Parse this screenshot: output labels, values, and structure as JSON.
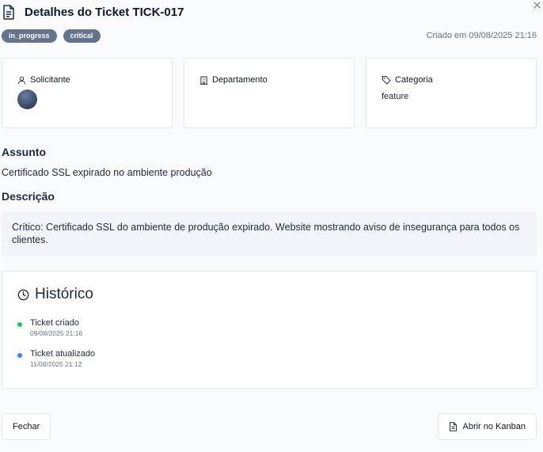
{
  "header": {
    "title": "Detalhes do Ticket TICK-017",
    "created": "Criado em 09/08/2025 21:16"
  },
  "badges": [
    "in_progress",
    "critical"
  ],
  "cards": {
    "requester": {
      "label": "Solicitante"
    },
    "department": {
      "label": "Departamento"
    },
    "category": {
      "label": "Categoria",
      "value": "feature"
    }
  },
  "subject": {
    "label": "Assunto",
    "text": "Certificado SSL expirado no ambiente produção"
  },
  "description": {
    "label": "Descrição",
    "text": "Crítico: Certificado SSL do ambiente de produção expirado. Website mostrando aviso de insegurança para todos os clientes."
  },
  "history": {
    "title": "Histórico",
    "events": [
      {
        "title": "Ticket criado",
        "date": "09/08/2025 21:16",
        "color": "#22c55e"
      },
      {
        "title": "Ticket atualizado",
        "date": "11/08/2025 21:12",
        "color": "#3b82f6"
      }
    ]
  },
  "footer": {
    "close_label": "Fechar",
    "kanban_label": "Abrir no Kanban"
  }
}
